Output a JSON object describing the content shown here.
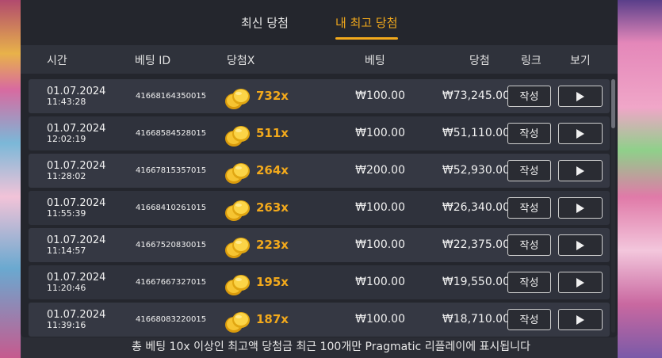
{
  "tabs": [
    {
      "label": "최신 당첨",
      "active": false
    },
    {
      "label": "내 최고 당첨",
      "active": true
    }
  ],
  "columns": {
    "time": "시간",
    "bet_id": "베팅 ID",
    "multiplier": "당첨X",
    "bet": "베팅",
    "win": "당첨",
    "link": "링크",
    "view": "보기"
  },
  "rows": [
    {
      "date": "01.07.2024",
      "time": "11:43:28",
      "bet_id": "41668164350015",
      "multiplier": "732x",
      "bet": "₩100.00",
      "win": "₩73,245.00",
      "link_label": "작성"
    },
    {
      "date": "01.07.2024",
      "time": "12:02:19",
      "bet_id": "41668584528015",
      "multiplier": "511x",
      "bet": "₩100.00",
      "win": "₩51,110.00",
      "link_label": "작성"
    },
    {
      "date": "01.07.2024",
      "time": "11:28:02",
      "bet_id": "41667815357015",
      "multiplier": "264x",
      "bet": "₩200.00",
      "win": "₩52,930.00",
      "link_label": "작성"
    },
    {
      "date": "01.07.2024",
      "time": "11:55:39",
      "bet_id": "41668410261015",
      "multiplier": "263x",
      "bet": "₩100.00",
      "win": "₩26,340.00",
      "link_label": "작성"
    },
    {
      "date": "01.07.2024",
      "time": "11:14:57",
      "bet_id": "41667520830015",
      "multiplier": "223x",
      "bet": "₩100.00",
      "win": "₩22,375.00",
      "link_label": "작성"
    },
    {
      "date": "01.07.2024",
      "time": "11:20:46",
      "bet_id": "41667667327015",
      "multiplier": "195x",
      "bet": "₩100.00",
      "win": "₩19,550.00",
      "link_label": "작성"
    },
    {
      "date": "01.07.2024",
      "time": "11:39:16",
      "bet_id": "41668083220015",
      "multiplier": "187x",
      "bet": "₩100.00",
      "win": "₩18,710.00",
      "link_label": "작성"
    }
  ],
  "footer": "총 베팅 10x 이상인 최고액 당첨금 최근 100개만 Pragmatic 리플레이에 표시됩니다",
  "colors": {
    "accent": "#f2a91c",
    "panel": "#24262d"
  },
  "icons": {
    "coins": "coins-icon",
    "play": "play-icon"
  }
}
